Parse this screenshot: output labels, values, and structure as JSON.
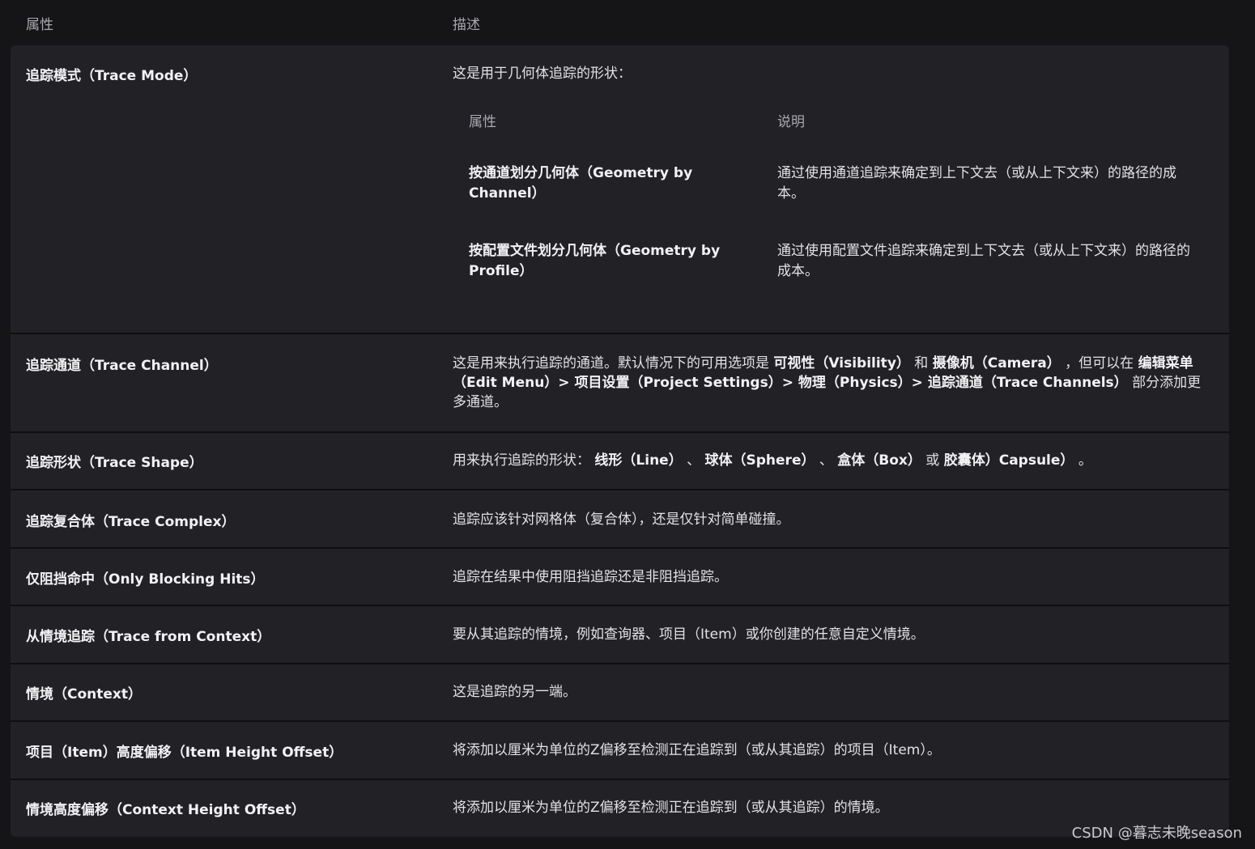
{
  "header": {
    "col_property": "属性",
    "col_description": "描述"
  },
  "trace_mode": {
    "property": "追踪模式（Trace Mode）",
    "description": "这是用于几何体追踪的形状：",
    "nested": {
      "col_property": "属性",
      "col_description": "说明",
      "rows": [
        {
          "property": "按通道划分几何体（Geometry by Channel）",
          "description": "通过使用通道追踪来确定到上下文去（或从上下文来）的路径的成本。"
        },
        {
          "property": "按配置文件划分几何体（Geometry by Profile）",
          "description": "通过使用配置文件追踪来确定到上下文去（或从上下文来）的路径的成本。"
        }
      ]
    }
  },
  "trace_channel": {
    "property": "追踪通道（Trace Channel）",
    "d1": "这是用来执行追踪的通道。默认情况下的可用选项是 ",
    "b1": "可视性（Visibility）",
    "d2": " 和 ",
    "b2": "摄像机（Camera）",
    "d3": " ，但可以在 ",
    "b3": "编辑菜单（Edit Menu）> 项目设置（Project Settings）> 物理（Physics）> 追踪通道（Trace Channels）",
    "d4": " 部分添加更多通道。"
  },
  "trace_shape": {
    "property": "追踪形状（Trace Shape）",
    "d1": "用来执行追踪的形状： ",
    "b1": "线形（Line）",
    "d2": " 、 ",
    "b2": "球体（Sphere）",
    "d3": " 、 ",
    "b3": "盒体（Box）",
    "d4": " 或 ",
    "b4": "胶囊体）Capsule）",
    "d5": " 。"
  },
  "rows": [
    {
      "property": "追踪复合体（Trace Complex）",
      "description": "追踪应该针对网格体（复合体），还是仅针对简单碰撞。"
    },
    {
      "property": "仅阻挡命中（Only Blocking Hits）",
      "description": "追踪在结果中使用阻挡追踪还是非阻挡追踪。"
    },
    {
      "property": "从情境追踪（Trace from Context）",
      "description": "要从其追踪的情境，例如查询器、项目（Item）或你创建的任意自定义情境。"
    },
    {
      "property": "情境（Context）",
      "description": "这是追踪的另一端。"
    },
    {
      "property": "项目（Item）高度偏移（Item Height Offset）",
      "description": "将添加以厘米为单位的Z偏移至检测正在追踪到（或从其追踪）的项目（Item）。"
    },
    {
      "property": "情境高度偏移（Context Height Offset）",
      "description": "将添加以厘米为单位的Z偏移至检测正在追踪到（或从其追踪）的情境。"
    }
  ],
  "watermark": "CSDN @暮志未晚season"
}
